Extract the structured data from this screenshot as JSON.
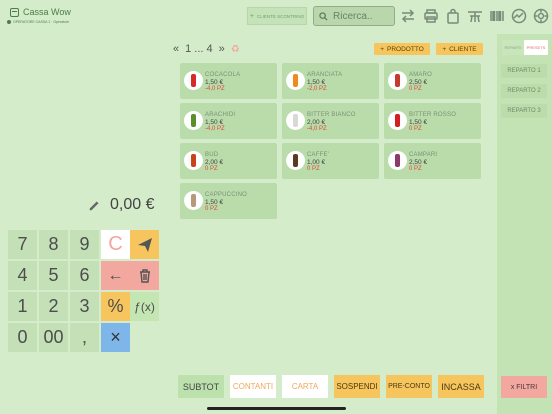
{
  "header": {
    "logo_text": "Cassa Wow",
    "operator_text": "OPERATORE CASSA 1 · Operatore",
    "customer_button": "CLIENTE SCONTRINO",
    "search_placeholder": "Ricerca..",
    "tool_icons": [
      "transfer-icon",
      "printer-icon",
      "bag-icon",
      "table-icon",
      "barcode-icon",
      "chart-icon",
      "settings-icon"
    ]
  },
  "pager": {
    "prev_all": "«",
    "pages": "1 ... 4",
    "next_all": "»"
  },
  "actions": {
    "add_product": "PRODOTTO",
    "add_customer": "CLIENTE",
    "plus": "+"
  },
  "products": [
    {
      "name": "COCACOLA",
      "price": "1,50 €",
      "stock": "-4,0 PZ",
      "color": "#d62a2a"
    },
    {
      "name": "ARANCIATA",
      "price": "1,50 €",
      "stock": "-2,0 PZ",
      "color": "#f08a1c"
    },
    {
      "name": "AMARO",
      "price": "2,50 €",
      "stock": "0 PZ",
      "color": "#c43b2b"
    },
    {
      "name": "ARACHIDI",
      "price": "1,50 €",
      "stock": "-4,0 PZ",
      "color": "#5a8f2a"
    },
    {
      "name": "BITTER BIANCO",
      "price": "2,00 €",
      "stock": "-4,0 PZ",
      "color": "#d8d8d8"
    },
    {
      "name": "BITTER ROSSO",
      "price": "1,50 €",
      "stock": "0 PZ",
      "color": "#d1201f"
    },
    {
      "name": "BUD",
      "price": "2,00 €",
      "stock": "0 PZ",
      "color": "#c8431a"
    },
    {
      "name": "CAFFE'",
      "price": "1,00 €",
      "stock": "0 PZ",
      "color": "#5b3a22"
    },
    {
      "name": "CAMPARI",
      "price": "2,50 €",
      "stock": "0 PZ",
      "color": "#8a3b6b"
    },
    {
      "name": "CAPPUCCINO",
      "price": "1,50 €",
      "stock": "0 PZ",
      "color": "#b89a7a"
    }
  ],
  "sidebar": {
    "tabs": [
      "REPARTI",
      "PRESETS"
    ],
    "departments": [
      "REPARTO 1",
      "REPARTO 2",
      "REPARTO 3"
    ],
    "filter_button": "x FILTRI"
  },
  "amount": {
    "value": "0,00 €"
  },
  "keypad": {
    "keys": [
      "7",
      "8",
      "9",
      "C",
      "4",
      "5",
      "6",
      "",
      "1",
      "2",
      "3",
      "%",
      "0",
      "00",
      ",",
      "×"
    ],
    "fx_label": "ƒ(x)"
  },
  "footer": {
    "subtot": "SUBTOT",
    "contanti": "CONTANTI",
    "carta": "CARTA",
    "sospendi": "SOSPENDI",
    "preconto": "PRE-CONTO",
    "incassa": "INCASSA"
  },
  "colors": {
    "background": "#d4ecc9",
    "accent_yellow": "#f7c55e",
    "accent_pink": "#f2a79f",
    "accent_blue": "#7fb6ea",
    "stock_negative": "#e0453a"
  }
}
